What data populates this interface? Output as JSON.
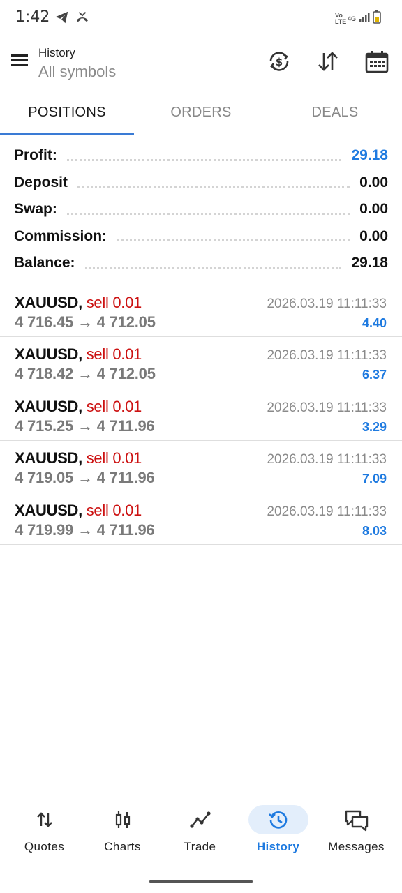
{
  "status_bar": {
    "time": "1:42",
    "left_icons": [
      "telegram-icon",
      "missed-call-icon"
    ],
    "right_icons": [
      "volte-icon",
      "signal-icon",
      "battery-icon"
    ],
    "volte_text": "Vo LTE",
    "network_text": "4G"
  },
  "app_bar": {
    "title": "History",
    "subtitle": "All symbols",
    "actions": [
      "currency-exchange-icon",
      "sort-icon",
      "calendar-icon"
    ]
  },
  "tabs": [
    {
      "label": "POSITIONS",
      "active": true
    },
    {
      "label": "ORDERS",
      "active": false
    },
    {
      "label": "DEALS",
      "active": false
    }
  ],
  "summary": [
    {
      "label": "Profit:",
      "value": "29.18"
    },
    {
      "label": "Deposit",
      "value": "0.00"
    },
    {
      "label": "Swap:",
      "value": "0.00"
    },
    {
      "label": "Commission:",
      "value": "0.00"
    },
    {
      "label": "Balance:",
      "value": "29.18"
    }
  ],
  "positions": [
    {
      "symbol": "XAUUSD,",
      "side": "sell 0.01",
      "open_price": "4 716.45",
      "arrow": "→",
      "close_price": "4 712.05",
      "time": "2026.03.19 11:11:33",
      "profit": "4.40"
    },
    {
      "symbol": "XAUUSD,",
      "side": "sell 0.01",
      "open_price": "4 718.42",
      "arrow": "→",
      "close_price": "4 712.05",
      "time": "2026.03.19 11:11:33",
      "profit": "6.37"
    },
    {
      "symbol": "XAUUSD,",
      "side": "sell 0.01",
      "open_price": "4 715.25",
      "arrow": "→",
      "close_price": "4 711.96",
      "time": "2026.03.19 11:11:33",
      "profit": "3.29"
    },
    {
      "symbol": "XAUUSD,",
      "side": "sell 0.01",
      "open_price": "4 719.05",
      "arrow": "→",
      "close_price": "4 711.96",
      "time": "2026.03.19 11:11:33",
      "profit": "7.09"
    },
    {
      "symbol": "XAUUSD,",
      "side": "sell 0.01",
      "open_price": "4 719.99",
      "arrow": "→",
      "close_price": "4 711.96",
      "time": "2026.03.19 11:11:33",
      "profit": "8.03"
    }
  ],
  "bottom_nav": [
    {
      "label": "Quotes",
      "icon": "quotes-arrows-icon",
      "active": false
    },
    {
      "label": "Charts",
      "icon": "candlestick-icon",
      "active": false
    },
    {
      "label": "Trade",
      "icon": "trend-line-icon",
      "active": false
    },
    {
      "label": "History",
      "icon": "history-icon",
      "active": true
    },
    {
      "label": "Messages",
      "icon": "chat-bubbles-icon",
      "active": false
    }
  ],
  "colors": {
    "accent": "#1e7ae0",
    "sell": "#cc1111",
    "muted": "#8a8a8a"
  }
}
